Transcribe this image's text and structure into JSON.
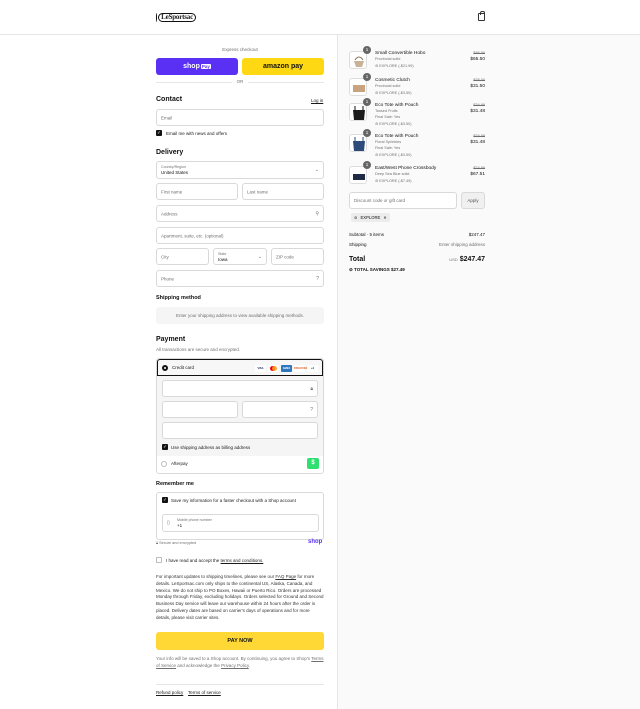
{
  "brand": {
    "name": "LeSportsac"
  },
  "express": {
    "label": "Express checkout",
    "shop_pay": "shop",
    "shop_pay_badge": "Pay",
    "amazon_pay": "amazon pay",
    "or": "OR"
  },
  "contact": {
    "title": "Contact",
    "login": "Log in",
    "email_placeholder": "Email",
    "news_label": "Email me with news and offers"
  },
  "delivery": {
    "title": "Delivery",
    "country_label": "Country/Region",
    "country_value": "United States",
    "first_name": "First name",
    "last_name": "Last name",
    "address": "Address",
    "apartment": "Apartment, suite, etc. (optional)",
    "city": "City",
    "state_label": "State",
    "state_value": "Iowa",
    "zip": "ZIP code",
    "phone": "Phone"
  },
  "shipping_method": {
    "title": "Shipping method",
    "message": "Enter your shipping address to view available shipping methods."
  },
  "payment": {
    "title": "Payment",
    "subtitle": "All transactions are secure and encrypted.",
    "credit_card": "Credit card",
    "card_brands": [
      "VISA",
      "MC",
      "AMEX",
      "DISCOVER"
    ],
    "more_brands": "+4",
    "billing_label": "Use shipping address as billing address",
    "afterpay": "Afterpay"
  },
  "remember": {
    "title": "Remember me",
    "save_label": "Save my information for a faster checkout with a Shop account",
    "phone_label": "Mobile phone number",
    "phone_value": "+1",
    "secure": "Secure and encrypted",
    "shop_logo": "shop"
  },
  "terms": {
    "label_prefix": "I have read and accept the ",
    "label_link": "terms and conditions."
  },
  "notice": {
    "p1": "For important updates to shipping timelines, please see our ",
    "faq": "FAQ Page",
    "p2": " for more details. LeSportsac.com only ships to the continental US, Alaska, Canada, and Mexico. We do not ship to PO Boxes, Hawaii or Puerto Rico. Orders are processed Monday through Friday, excluding holidays. Orders selected for Ground and Second Business Day service will leave our warehouse within 24 hours after the order is placed. Delivery dates are based on carrier's days of operations and for more details, please visit carrier sites."
  },
  "pay_now": "PAY NOW",
  "shop_note": {
    "p1": "Your info will be saved to a Shop account. By continuing, you agree to Shop's ",
    "tos": "Terms of Service",
    "p2": " and acknowledge the ",
    "privacy": "Privacy Policy",
    "p3": "."
  },
  "footer": {
    "refund": "Refund policy",
    "terms": "Terms of service"
  },
  "order": {
    "items": [
      {
        "qty": "1",
        "name": "Small Convertible Hobo",
        "meta1": "Provincial solid",
        "meta2": "",
        "discount": "EXPLORE (-$21.99)",
        "old_price": "$86.99",
        "price": "$65.50",
        "color": "#c9b295"
      },
      {
        "qty": "1",
        "name": "Cosmetic Clutch",
        "meta1": "Provincial solid",
        "meta2": "",
        "discount": "EXPLORE (-$3.50)",
        "old_price": "$35.00",
        "price": "$31.50",
        "color": "#c9a27e"
      },
      {
        "qty": "1",
        "name": "Eco Tote with Pouch",
        "meta1": "Tossed Fruits",
        "meta2": "Final Sale: Yes",
        "discount": "EXPLORE (-$3.50)",
        "old_price": "$34.98",
        "price": "$31.48",
        "color": "#1d1d1d"
      },
      {
        "qty": "1",
        "name": "Eco Tote with Pouch",
        "meta1": "Floral Sprinkles",
        "meta2": "Final Sale: Yes",
        "discount": "EXPLORE (-$3.50)",
        "old_price": "$34.98",
        "price": "$31.48",
        "color": "#2e4a7a"
      },
      {
        "qty": "1",
        "name": "East/West Phone Crossbody",
        "meta1": "Deep Sea Blue solid",
        "meta2": "",
        "discount": "EXPLORE (-$7.49)",
        "old_price": "$74.99",
        "price": "$67.51",
        "color": "#1f2a44"
      }
    ],
    "discount_placeholder": "Discount code or gift card",
    "apply": "Apply",
    "code_tag": "EXPLORE",
    "subtotal_label": "Subtotal · 5 items",
    "subtotal_value": "$247.47",
    "shipping_label": "Shipping",
    "shipping_value": "Enter shipping address",
    "total_label": "Total",
    "currency": "USD",
    "total_value": "$247.47",
    "savings_label": "TOTAL SAVINGS",
    "savings_value": "$27.49"
  }
}
